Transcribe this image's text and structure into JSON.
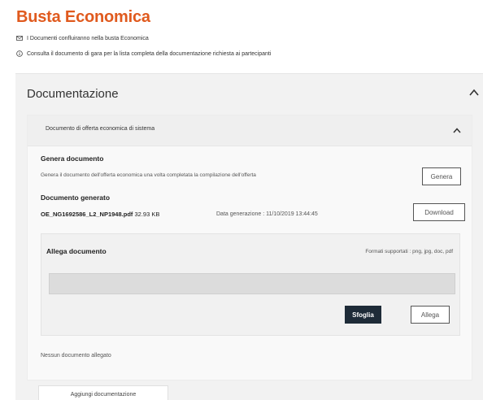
{
  "page": {
    "title": "Busta Economica",
    "info_1": "I Documenti confluiranno nella busta Economica",
    "info_2": "Consulta il documento di gara per la lista completa della documentazione richiesta ai partecipanti"
  },
  "documentazione": {
    "header": "Documentazione",
    "section": {
      "header": "Documento di offerta economica di sistema",
      "genera": {
        "label": "Genera documento",
        "description": "Genera il documento dell'offerta economica una volta completata la compilazione dell'offerta",
        "button": "Genera"
      },
      "generato": {
        "label": "Documento generato",
        "filename": "OE_NG1692586_L2_NP1948.pdf",
        "filesize": "32.93 KB",
        "date": "Data generazione : 11/10/2019 13:44:45",
        "button": "Download"
      },
      "allega": {
        "label": "Allega documento",
        "formats": "Formati supportati : png, jpg, doc, pdf",
        "browse_button": "Sfoglia",
        "attach_button": "Allega"
      },
      "no_attachments": "Nessun documento allegato"
    },
    "add_button": "Aggiungi documentazione"
  }
}
